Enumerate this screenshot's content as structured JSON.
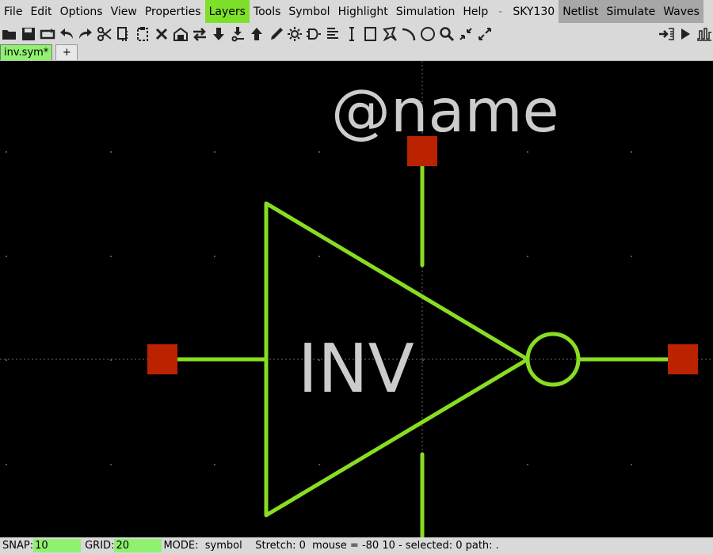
{
  "menubar": {
    "items": [
      "File",
      "Edit",
      "Options",
      "View",
      "Properties",
      "Layers",
      "Tools",
      "Symbol",
      "Highlight",
      "Simulation",
      "Help"
    ],
    "active_item": "Layers",
    "separator": "-",
    "pdk": "SKY130",
    "buttons": [
      "Netlist",
      "Simulate",
      "Waves"
    ]
  },
  "toolbar": {
    "icons": [
      "open-folder-icon",
      "save-icon",
      "reload-icon",
      "undo-icon",
      "redo-icon",
      "cut-icon",
      "copy-icon",
      "paste-icon",
      "delete-icon",
      "move-icon",
      "swap-icon",
      "push-down-icon",
      "push-down-pin-icon",
      "pop-up-icon",
      "pencil-icon",
      "light-icon",
      "gate-icon",
      "align-icon",
      "pin-icon",
      "rect-icon",
      "polygon-icon",
      "arc-icon",
      "circle-icon",
      "zoom-icon",
      "zoom-in-icon",
      "zoom-fit-icon"
    ],
    "right_icons": [
      "netlist-arrow-icon",
      "play-icon",
      "waveform-icon"
    ]
  },
  "tabs": {
    "active": "inv.sym*",
    "add_label": "+"
  },
  "canvas": {
    "name_label": "@name",
    "symbol_label": "INV",
    "colors": {
      "background": "#000000",
      "wire": "#88dd22",
      "pin": "#bb2200",
      "text": "#cccccc",
      "grid": "#555555"
    }
  },
  "status": {
    "snap_label": "SNAP:",
    "snap_value": "10",
    "grid_label": "GRID:",
    "grid_value": "20",
    "mode_text": "MODE:  symbol    Stretch: 0  mouse = -80 10 - selected: 0 path: ."
  }
}
